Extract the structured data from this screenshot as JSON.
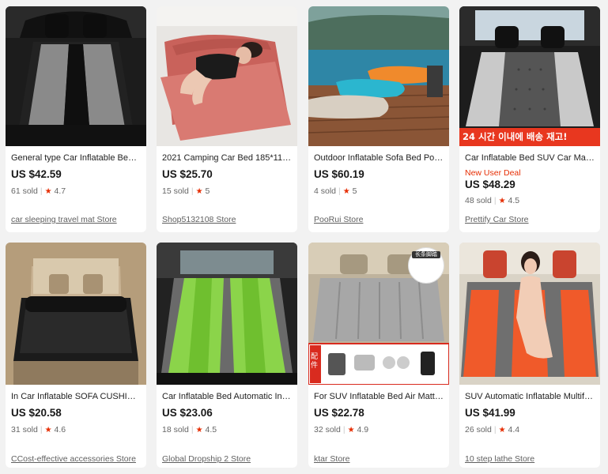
{
  "products": [
    {
      "title": "General type Car Inflatable Bed SU...",
      "price": "US $42.59",
      "sold": "61 sold",
      "rating": "4.7",
      "store": "car sleeping travel mat Store",
      "image": "suv-black-grey-mattress"
    },
    {
      "title": "2021 Camping Car Bed 185*110C...",
      "price": "US $25.70",
      "sold": "15 sold",
      "rating": "5",
      "store": "Shop5132108 Store",
      "image": "woman-on-pink-air-mattress"
    },
    {
      "title": "Outdoor Inflatable Sofa Bed Porta...",
      "price": "US $60.19",
      "sold": "4 sold",
      "rating": "5",
      "store": "PooRui Store",
      "image": "inflatable-loungers-poolside"
    },
    {
      "title": "Car Inflatable Bed SUV Car Mattres...",
      "deal": "New User Deal",
      "price": "US $48.29",
      "sold": "48 sold",
      "rating": "4.5",
      "store": "Prettify Car Store",
      "image": "suv-grey-mattress-korean-banner",
      "banner": "24 시간 이내에 배송 재고!"
    },
    {
      "title": "In Car Inflatable SOFA CUSHION B...",
      "price": "US $20.58",
      "sold": "31 sold",
      "rating": "4.6",
      "store": "CCost-effective accessories Store",
      "image": "black-air-mattress-car-interior"
    },
    {
      "title": "Car Inflatable Bed Automatic Inflat...",
      "price": "US $23.06",
      "sold": "18 sold",
      "rating": "4.5",
      "store": "Global Dropship 2 Store",
      "image": "green-grey-mattress-suv"
    },
    {
      "title": "For SUV Inflatable Bed Air Mattres...",
      "price": "US $22.78",
      "sold": "32 sold",
      "rating": "4.9",
      "store": "ktar Store",
      "image": "grey-air-mattress-accessories",
      "badge": "长条脚踏",
      "accessory_label": "配件"
    },
    {
      "title": "SUV Automatic Inflatable Multifun...",
      "price": "US $41.99",
      "sold": "26 sold",
      "rating": "4.4",
      "store": "10 step lathe Store",
      "image": "woman-on-orange-grey-mattress"
    }
  ],
  "colors": {
    "price_red": "#e62e04",
    "star": "#e62e04",
    "background": "#f2f2f2"
  }
}
